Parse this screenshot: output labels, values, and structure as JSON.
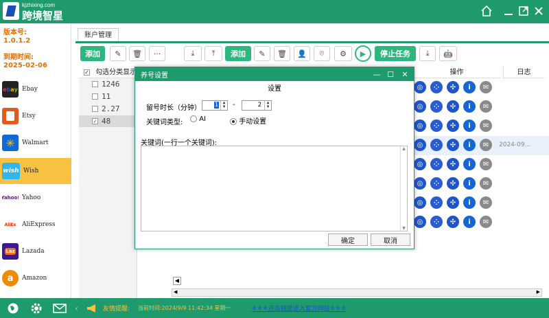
{
  "app": {
    "logo_small": "kjzhixing.com",
    "logo_main": "跨境智星"
  },
  "sidebar": {
    "version_label": "版本号:",
    "version_value": "1.0.1.2",
    "expire_label": "到期时间:",
    "expire_value": "2025-02-06",
    "platforms": [
      {
        "label": "Ebay",
        "color": "#222222",
        "icon": "ebay-icon"
      },
      {
        "label": "Etsy",
        "color": "#e25a1c",
        "icon": "etsy-icon"
      },
      {
        "label": "Walmart",
        "color": "#1169d8",
        "icon": "walmart-icon"
      },
      {
        "label": "Wish",
        "color": "#2fb7ec",
        "icon": "wish-icon"
      },
      {
        "label": "Yahoo",
        "color": "#ffffff",
        "icon": "yahoo-icon"
      },
      {
        "label": "AliExpress",
        "color": "#ffffff",
        "icon": "aliexpress-icon"
      },
      {
        "label": "Lazada",
        "color": "#3a1a8c",
        "icon": "lazada-icon"
      },
      {
        "label": "Amazon",
        "color": "#f08a00",
        "icon": "amazon-icon"
      }
    ],
    "active_platform": "Wish"
  },
  "tabs": [
    "账户管理"
  ],
  "toolbar_left": {
    "add_label": "添加"
  },
  "toolbar_right": {
    "add_label": "添加",
    "stop_label": "停止任务"
  },
  "grid": {
    "header_category": "勾选分类显示",
    "header_actions": "操作",
    "header_log": "日志",
    "categories": [
      {
        "label": "1246",
        "checked": false
      },
      {
        "label": "11",
        "checked": false
      },
      {
        "label": "2.27",
        "checked": false
      },
      {
        "label": "48",
        "checked": true
      }
    ],
    "log_value": "2024-09..."
  },
  "dialog": {
    "title": "养号设置",
    "section_title": "设置",
    "duration_label": "留号时长（分钟）",
    "duration_min": "1",
    "duration_sep": "-",
    "duration_max": "2",
    "keyword_type_label": "关键词类型:",
    "radio_ai": "AI",
    "radio_manual": "手动设置",
    "keywords_label": "关键词(一行一个关键词):",
    "keywords_value": "",
    "ok_label": "确定",
    "cancel_label": "取消"
  },
  "status": {
    "tip_label": "友情提醒:",
    "time_text": "当前时间:2024/9/9  11:42:34 星期一",
    "link_text": "⚘⚘⚘点击链接进入官方网站⚘⚘⚘"
  }
}
